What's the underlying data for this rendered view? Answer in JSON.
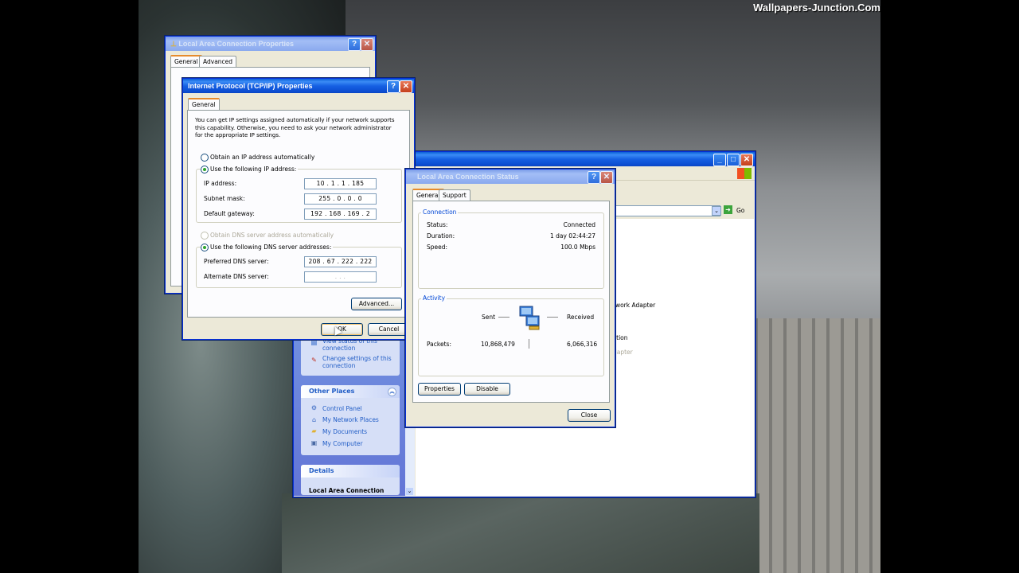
{
  "watermark": "Wallpapers-Junction.Com",
  "lac_props": {
    "title": "Local Area Connection Properties",
    "tabs": [
      "General",
      "Advanced"
    ]
  },
  "tcpip": {
    "title": "Internet Protocol (TCP/IP) Properties",
    "tab": "General",
    "intro": "You can get IP settings assigned automatically if your network supports this capability. Otherwise, you need to ask your network administrator for the appropriate IP settings.",
    "radio_auto_ip": "Obtain an IP address automatically",
    "radio_manual_ip": "Use the following IP address:",
    "ip_label": "IP address:",
    "ip_value": "10 .  1  .  1  . 185",
    "subnet_label": "Subnet mask:",
    "subnet_value": "255 .  0  .  0  .  0",
    "gateway_label": "Default gateway:",
    "gateway_value": "192 . 168 . 169 .  2",
    "radio_auto_dns": "Obtain DNS server address automatically",
    "radio_manual_dns": "Use the following DNS server addresses:",
    "pref_dns_label": "Preferred DNS server:",
    "pref_dns_value": "208 .  67 . 222 . 222",
    "alt_dns_label": "Alternate DNS server:",
    "alt_dns_value": ".     .     .",
    "advanced": "Advanced...",
    "ok": "OK",
    "cancel": "Cancel"
  },
  "status": {
    "title": "Local Area Connection Status",
    "tabs": [
      "General",
      "Support"
    ],
    "connection_legend": "Connection",
    "status_label": "Status:",
    "status_value": "Connected",
    "duration_label": "Duration:",
    "duration_value": "1 day 02:44:27",
    "speed_label": "Speed:",
    "speed_value": "100.0 Mbps",
    "activity_legend": "Activity",
    "sent_label": "Sent",
    "received_label": "Received",
    "packets_label": "Packets:",
    "packets_sent": "10,868,479",
    "packets_received": "6,066,316",
    "properties": "Properties",
    "disable": "Disable",
    "close": "Close"
  },
  "explorer": {
    "go": "Go",
    "frag1": "twork Adapter",
    "frag2": "ction",
    "frag3": "dapter",
    "task_items": [
      "View status of this connection",
      "Change settings of this connection"
    ],
    "other_places_title": "Other Places",
    "other_places": [
      "Control Panel",
      "My Network Places",
      "My Documents",
      "My Computer"
    ],
    "details_title": "Details",
    "details_item": "Local Area Connection"
  }
}
